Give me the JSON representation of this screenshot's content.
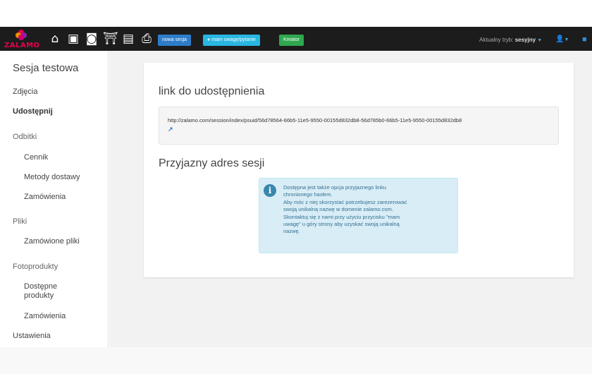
{
  "brand": {
    "logo_text": "ZALAMO"
  },
  "nav": {
    "icons": [
      "home-icon",
      "book-icon",
      "camera-icon",
      "gift-icon",
      "portrait-icon",
      "print-icon"
    ],
    "buttons": {
      "new_session": "nowa sesja",
      "question": "mam uwagę/pytanie",
      "creator": "Kreator"
    },
    "mode_label": "Aktualny tryb:",
    "mode_value": "sesyjny"
  },
  "sidebar": {
    "title": "Sesja testowa",
    "items": [
      {
        "label": "Zdjęcia"
      },
      {
        "label": "Udostępnij"
      },
      {
        "label": "Odbitki"
      },
      {
        "label": "Cennik"
      },
      {
        "label": "Metody dostawy"
      },
      {
        "label": "Zamówienia"
      },
      {
        "label": "Pliki"
      },
      {
        "label": "Zamówione pliki"
      },
      {
        "label": "Fotoprodukty"
      },
      {
        "label": "Dostępne produkty"
      },
      {
        "label": "Zamówienia"
      },
      {
        "label": "Ustawienia"
      }
    ]
  },
  "main": {
    "link_heading": "link do udostępnienia",
    "link_url": "http://zalamo.com/session/index/psuid/56d78564-66b5-11e5-9550-00155d832db8-56d785b0-66b5-11e5-9550-00155d832db8",
    "friendly_heading": "Przyjazny adres sesji",
    "alert_lines": [
      "Dostępna jest także opcja przyjaznego linku",
      "chronionego hasłem.",
      "Aby móc z niej skorzystać potrzebujesz zarezerować",
      "swoją unikalną nazwę w domenie zalamo.com.",
      "Skontaktuj się z nami przy użyciu przycisku \"mam",
      "uwagę\" u góry strony aby uzyskać swoją unikalną",
      "nazwę."
    ]
  },
  "colors": {
    "navbar": "#1c1c1c",
    "btn_blue": "#2d7dc9",
    "btn_cyan": "#29b6e0",
    "btn_green": "#2fa84f",
    "alert_bg": "#d9edf7",
    "alert_text": "#31708f"
  }
}
